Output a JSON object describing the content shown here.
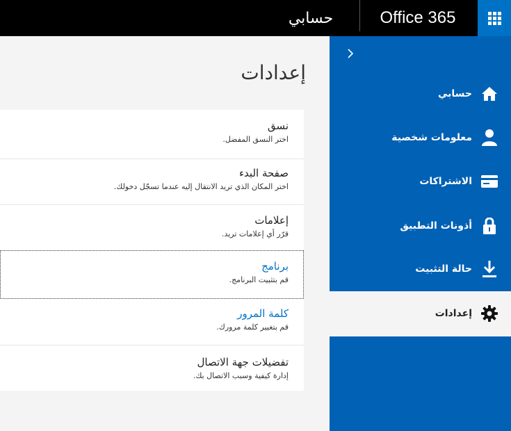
{
  "header": {
    "app_name": "Office 365",
    "section_title": "حسابي",
    "launcher_icon": "app-launcher-waffle-icon"
  },
  "sidebar": {
    "collapse_icon": "chevron-right-icon",
    "items": [
      {
        "label": "حسابي",
        "icon": "home-icon"
      },
      {
        "label": "معلومات شخصية",
        "icon": "person-icon"
      },
      {
        "label": "الاشتراكات",
        "icon": "credit-card-icon"
      },
      {
        "label": "أذونات التطبيق",
        "icon": "lock-icon"
      },
      {
        "label": "حالة التثبيت",
        "icon": "download-icon"
      },
      {
        "label": "إعدادات",
        "icon": "gear-icon",
        "active": true
      }
    ],
    "color": "#0061b5"
  },
  "main": {
    "title": "إعدادات",
    "settings": [
      {
        "title": "نسق",
        "description": "اختر النسق المفضل."
      },
      {
        "title": "صفحة البدء",
        "description": "اختر المكان الذي تريد الانتقال إليه عندما تسجّل دخولك."
      },
      {
        "title": "إعلامات",
        "description": "قرّر أي إعلامات تريد."
      },
      {
        "title": "برنامج",
        "description": "قم بتثبيت البرنامج.",
        "link": true
      },
      {
        "title": "كلمة المرور",
        "description": "قم بتغيير كلمة مرورك.",
        "link": true
      },
      {
        "title": "تفضيلات جهة الاتصال",
        "description": "إدارة كيفية وسبب الاتصال بك."
      }
    ]
  },
  "colors": {
    "topbar": "#000000",
    "accent": "#0072c6",
    "link": "#0072c6"
  }
}
